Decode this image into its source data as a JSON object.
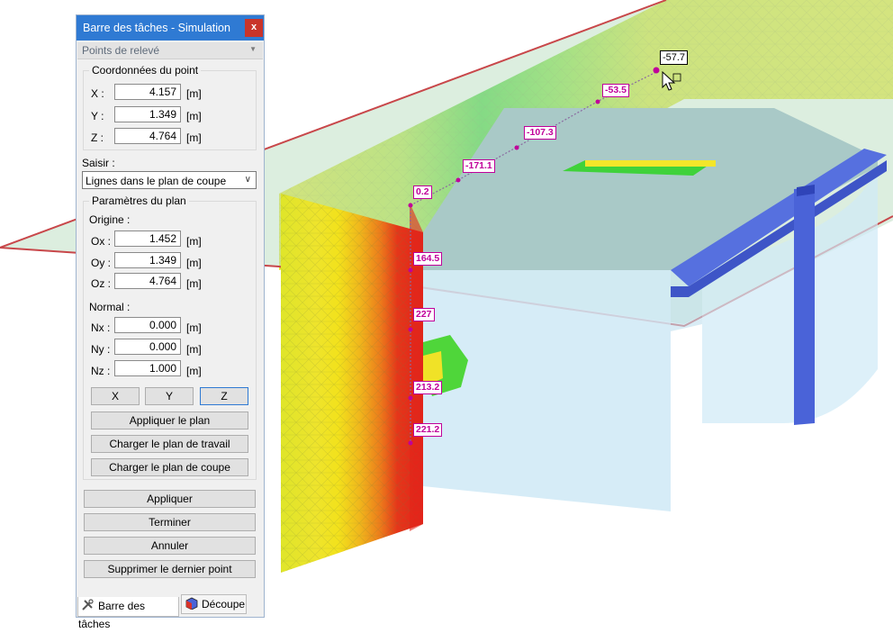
{
  "window": {
    "title": "Barre des tâches - Simulation",
    "close_label": "x"
  },
  "section": {
    "label": "Points de relevé"
  },
  "point_coords": {
    "title": "Coordonnées du point",
    "rows": [
      {
        "label": "X :",
        "value": "4.157",
        "unit": "[m]"
      },
      {
        "label": "Y :",
        "value": "1.349",
        "unit": "[m]"
      },
      {
        "label": "Z :",
        "value": "4.764",
        "unit": "[m]"
      }
    ]
  },
  "capture": {
    "label": "Saisir :",
    "selected": "Lignes dans le plan de coupe"
  },
  "plane": {
    "title": "Paramètres du plan",
    "origin_label": "Origine :",
    "origin": [
      {
        "label": "Ox :",
        "value": "1.452",
        "unit": "[m]"
      },
      {
        "label": "Oy :",
        "value": "1.349",
        "unit": "[m]"
      },
      {
        "label": "Oz :",
        "value": "4.764",
        "unit": "[m]"
      }
    ],
    "normal_label": "Normal :",
    "normal": [
      {
        "label": "Nx :",
        "value": "0.000",
        "unit": "[m]"
      },
      {
        "label": "Ny :",
        "value": "0.000",
        "unit": "[m]"
      },
      {
        "label": "Nz :",
        "value": "1.000",
        "unit": "[m]"
      }
    ],
    "axis_buttons": [
      "X",
      "Y",
      "Z"
    ],
    "apply_plane": "Appliquer le plan",
    "load_work_plane": "Charger le plan de travail",
    "load_cut_plane": "Charger le plan de coupe"
  },
  "actions": {
    "apply": "Appliquer",
    "finish": "Terminer",
    "cancel": "Annuler",
    "delete_last": "Supprimer le dernier point"
  },
  "tabs": [
    {
      "label": "Barre des tâches",
      "icon": "tools-icon"
    },
    {
      "label": "Découpe",
      "icon": "cube-icon"
    }
  ],
  "viewport": {
    "cursor_value": "-57.7",
    "point_labels": [
      "-53.5",
      "-107.3",
      "-171.1",
      "0.2",
      "164.5",
      "227",
      "213.2",
      "221.2"
    ],
    "colors": {
      "cut_plane_edge": "#c8474a",
      "label_magenta": "#c0009a",
      "beam_blue": "#4a63d8",
      "hot_red": "#e3241a",
      "field_yellow": "#f4e41c",
      "field_green": "#3fd23a"
    }
  }
}
